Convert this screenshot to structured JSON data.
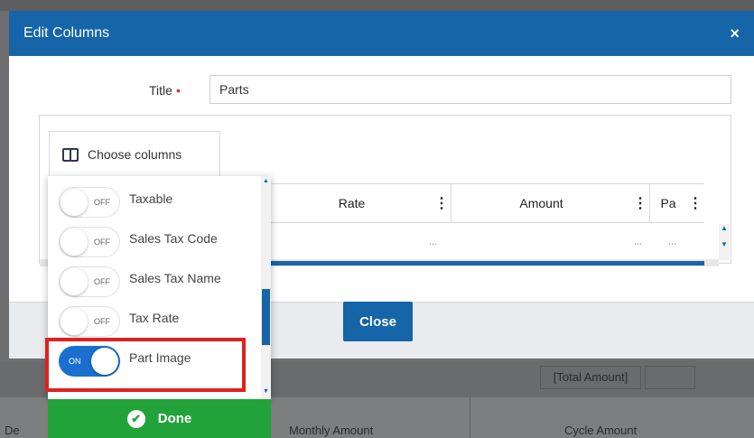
{
  "modal": {
    "title": "Edit Columns",
    "close_icon": "×",
    "title_label": "Title",
    "title_required_mark": "•",
    "title_value": "Parts",
    "close_button": "Close"
  },
  "grid": {
    "choose_columns_label": "Choose columns",
    "columns": [
      {
        "label": "Rate"
      },
      {
        "label": "Amount"
      },
      {
        "label": "Pa"
      }
    ],
    "row_cells": [
      "...",
      "...",
      "..."
    ]
  },
  "column_options": [
    {
      "label": "Taxable",
      "state": "OFF"
    },
    {
      "label": "Sales Tax Code",
      "state": "OFF"
    },
    {
      "label": "Sales Tax Name",
      "state": "OFF"
    },
    {
      "label": "Tax Rate",
      "state": "OFF"
    },
    {
      "label": "Part Image",
      "state": "ON"
    }
  ],
  "done_button": "Done",
  "background": {
    "total_amount": "[Total Amount]",
    "bottom_labels": [
      "De",
      "Monthly Amount",
      "Cycle Amount"
    ]
  },
  "colors": {
    "header_blue": "#1565a8",
    "toggle_on": "#1a6fd0",
    "done_green": "#22a33a",
    "highlight_red": "#e02020"
  }
}
